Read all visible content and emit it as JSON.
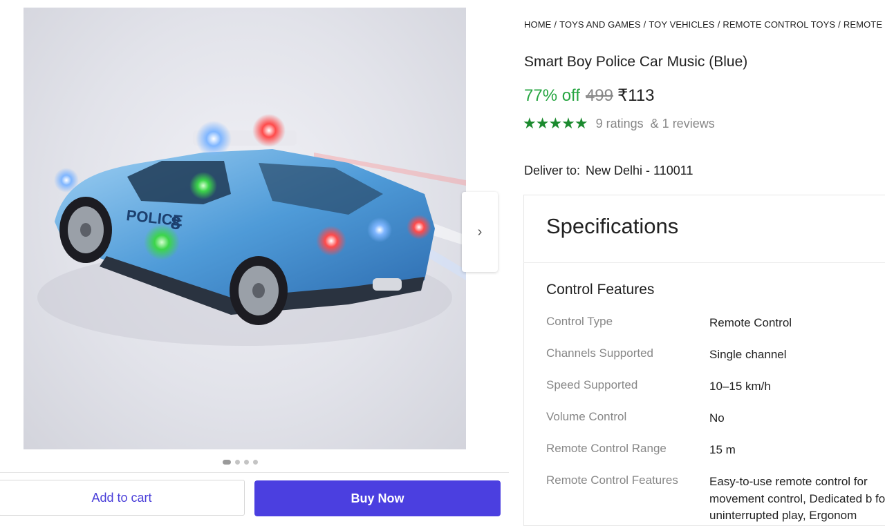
{
  "product_image": {
    "description_icon": "police-car-toy-image"
  },
  "gallery": {
    "dots": 4,
    "active_index": 0
  },
  "actions": {
    "add_to_cart": "Add to cart",
    "buy_now": "Buy Now"
  },
  "breadcrumb": [
    "HOME",
    "TOYS AND GAMES",
    "TOY VEHICLES",
    "REMOTE CONTROL TOYS",
    "REMOTE C"
  ],
  "product": {
    "title": "Smart Boy Police Car Music (Blue)",
    "discount": "77% off",
    "mrp": "499",
    "price": "₹113",
    "stars": "★★★★★",
    "rating_value": 5,
    "ratings": "9 ratings",
    "reviews": "& 1 reviews"
  },
  "delivery": {
    "label": "Deliver to:",
    "location": "New Delhi - 110011"
  },
  "specifications": {
    "title": "Specifications",
    "group": "Control Features",
    "rows": [
      {
        "key": "Control Type",
        "value": "Remote Control"
      },
      {
        "key": "Channels Supported",
        "value": "Single channel"
      },
      {
        "key": "Speed Supported",
        "value": "10–15 km/h"
      },
      {
        "key": "Volume Control",
        "value": "No"
      },
      {
        "key": "Remote Control Range",
        "value": "15 m"
      },
      {
        "key": "Remote Control Features",
        "value": "Easy-to-use remote control for movement control, Dedicated b for uninterrupted play, Ergonom"
      }
    ]
  },
  "colors": {
    "accent": "#4b3fe0",
    "discount": "#26a541",
    "stars": "#1b8a2e"
  }
}
